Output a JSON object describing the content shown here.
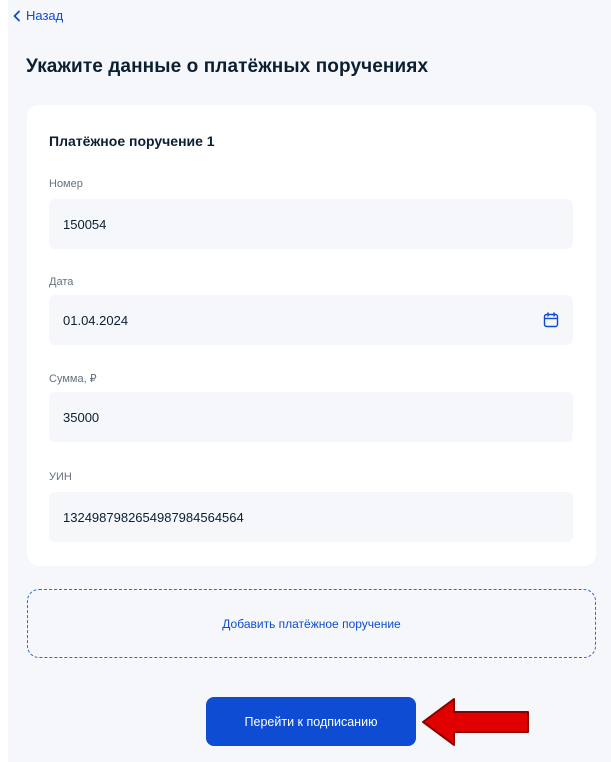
{
  "nav": {
    "back_label": "Назад"
  },
  "page": {
    "title": "Укажите данные о платёжных поручениях"
  },
  "payment_order": {
    "title": "Платёжное поручение 1",
    "fields": {
      "number": {
        "label": "Номер",
        "value": "150054"
      },
      "date": {
        "label": "Дата",
        "value": "01.04.2024"
      },
      "amount": {
        "label": "Сумма, ₽",
        "value": "35000"
      },
      "uin": {
        "label": "УИН",
        "value": "1324987982654987984564564"
      }
    }
  },
  "actions": {
    "add_label": "Добавить платёжное поручение",
    "submit_label": "Перейти к подписанию"
  },
  "colors": {
    "accent": "#0d4cd3",
    "annotation_arrow": "#e00000"
  },
  "icons": {
    "back": "chevron-left-icon",
    "date": "calendar-icon",
    "annotation": "red-arrow-icon"
  }
}
